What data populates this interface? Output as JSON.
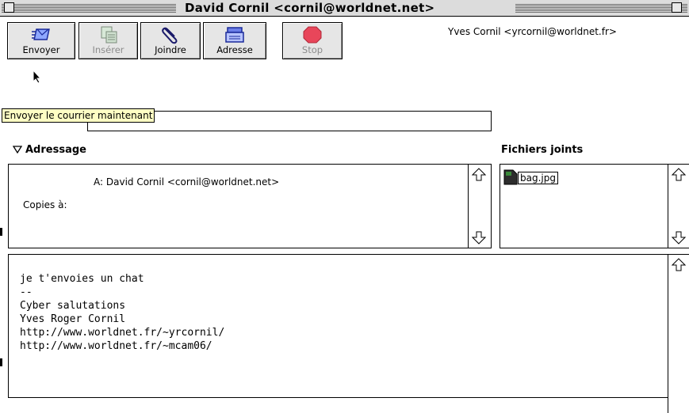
{
  "window": {
    "title": "David Cornil <cornil@worldnet.net>"
  },
  "toolbar": {
    "buttons": [
      {
        "label": "Envoyer",
        "icon": "envelope-send-icon",
        "enabled": true
      },
      {
        "label": "Insérer",
        "icon": "insert-document-icon",
        "enabled": false
      },
      {
        "label": "Joindre",
        "icon": "paperclip-icon",
        "enabled": true
      },
      {
        "label": "Adresse",
        "icon": "address-book-icon",
        "enabled": true
      },
      {
        "label": "Stop",
        "icon": "stop-sign-icon",
        "enabled": false
      }
    ]
  },
  "sender": "Yves Cornil <yrcornil@worldnet.fr>",
  "tooltip": "Envoyer le courrier maintenant",
  "addressing": {
    "header": "Adressage",
    "to_label": "A:",
    "to_value": "David Cornil <cornil@worldnet.net>",
    "cc_label": "Copies à:"
  },
  "attachments": {
    "header": "Fichiers joints",
    "files": [
      "bag.jpg"
    ]
  },
  "body": {
    "text": "je t'envoies un chat\n--\nCyber salutations\nYves Roger Cornil\nhttp://www.worldnet.fr/~yrcornil/\nhttp://www.worldnet.fr/~mcam06/"
  },
  "colors": {
    "stop": "#e8465a",
    "tooltip_bg": "#ffffc4",
    "chrome": "#dcdcdc"
  }
}
